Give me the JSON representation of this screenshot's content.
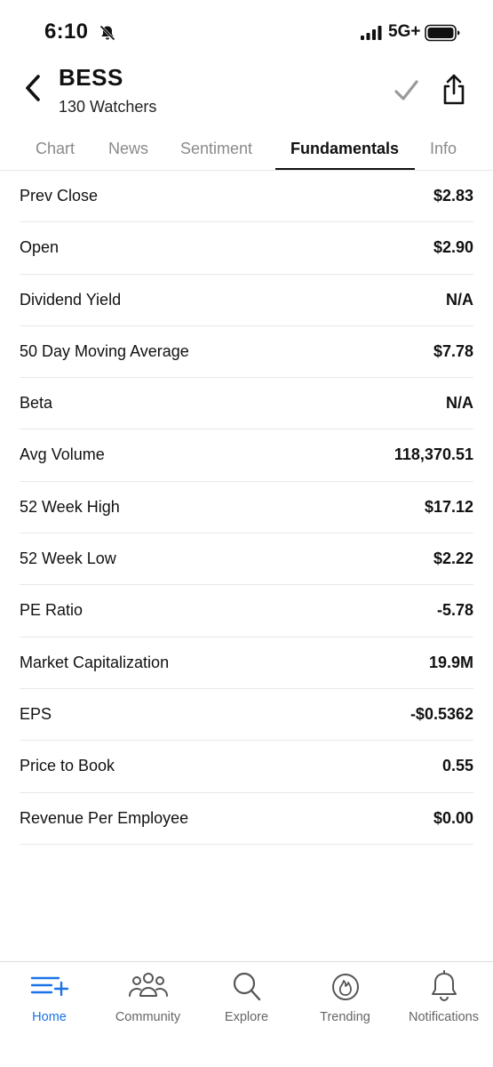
{
  "status": {
    "time": "6:10",
    "network": "5G+"
  },
  "header": {
    "title": "BESS",
    "subtitle": "130 Watchers"
  },
  "tabs": [
    {
      "label": "Chart"
    },
    {
      "label": "News"
    },
    {
      "label": "Sentiment"
    },
    {
      "label": "Fundamentals"
    },
    {
      "label": "Info"
    }
  ],
  "active_tab": "Fundamentals",
  "fundamentals": [
    {
      "label": "Prev Close",
      "value": "$2.83"
    },
    {
      "label": "Open",
      "value": "$2.90"
    },
    {
      "label": "Dividend Yield",
      "value": "N/A"
    },
    {
      "label": "50 Day Moving Average",
      "value": "$7.78"
    },
    {
      "label": "Beta",
      "value": "N/A"
    },
    {
      "label": "Avg Volume",
      "value": "118,370.51"
    },
    {
      "label": "52 Week High",
      "value": "$17.12"
    },
    {
      "label": "52 Week Low",
      "value": "$2.22"
    },
    {
      "label": "PE Ratio",
      "value": "-5.78"
    },
    {
      "label": "Market Capitalization",
      "value": "19.9M"
    },
    {
      "label": "EPS",
      "value": "-$0.5362"
    },
    {
      "label": "Price to Book",
      "value": "0.55"
    },
    {
      "label": "Revenue Per Employee",
      "value": "$0.00"
    }
  ],
  "bottom_nav": [
    {
      "label": "Home",
      "icon": "home-list-plus-icon"
    },
    {
      "label": "Community",
      "icon": "people-icon"
    },
    {
      "label": "Explore",
      "icon": "search-icon"
    },
    {
      "label": "Trending",
      "icon": "flame-icon"
    },
    {
      "label": "Notifications",
      "icon": "bell-icon"
    }
  ],
  "colors": {
    "accent": "#1a73e8",
    "inactive_tab": "#8a8a8a",
    "divider": "#e8e8e8"
  }
}
